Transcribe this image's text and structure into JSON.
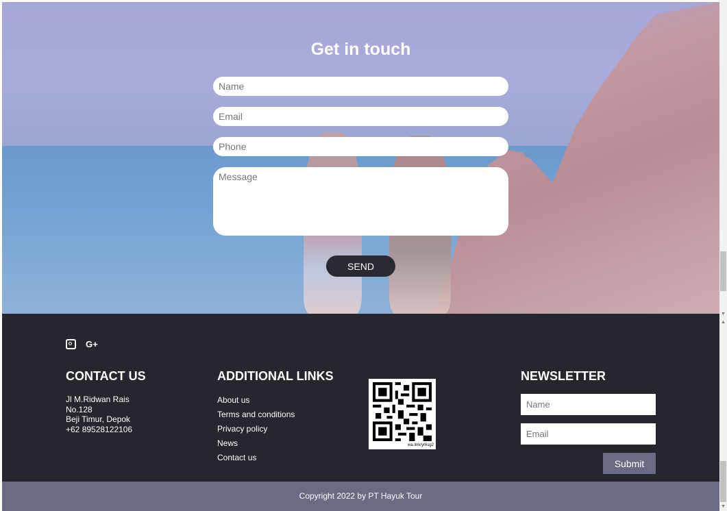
{
  "contact_form": {
    "title": "Get in touch",
    "name_placeholder": "Name",
    "email_placeholder": "Email",
    "phone_placeholder": "Phone",
    "message_placeholder": "Message",
    "send_label": "SEND"
  },
  "footer": {
    "social_icons": [
      "instagram-icon",
      "google-plus-icon"
    ],
    "google_plus_glyph": "G+",
    "contact": {
      "title": "CONTACT US",
      "address_line1": "Jl M.Ridwan Rais",
      "address_line2": "No.128",
      "address_line3": "Beji Timur, Depok",
      "phone": "+62 89528122106"
    },
    "links": {
      "title": "ADDITIONAL LINKS",
      "items": [
        "About us",
        "Terms and conditions",
        "Privacy policy",
        "News",
        "Contact us"
      ]
    },
    "qr": {
      "caption": "wa.link/yr6sg2"
    },
    "newsletter": {
      "title": "NEWSLETTER",
      "name_placeholder": "Name",
      "email_placeholder": "Email",
      "submit_label": "Submit"
    },
    "copyright": "Copyright 2022 by PT Hayuk Tour"
  },
  "colors": {
    "footer_bg": "#26262e",
    "copyright_bg": "#6a6a85",
    "send_button": "#2a2a33",
    "submit_button": "#6a6a85"
  }
}
